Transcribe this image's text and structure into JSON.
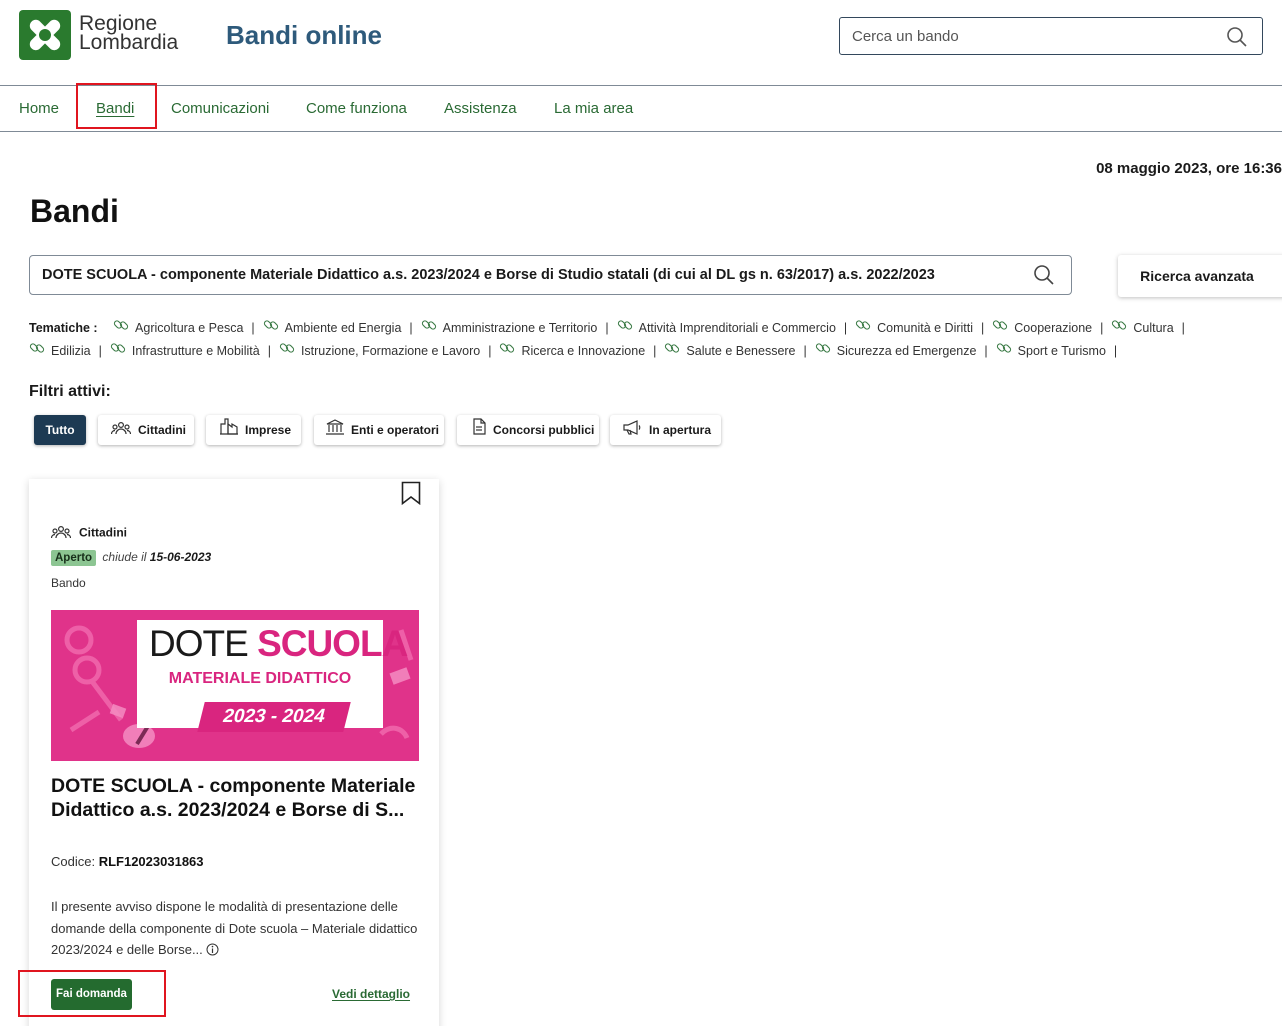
{
  "header": {
    "brand_line1": "Regione",
    "brand_line2": "Lombardia",
    "app_title": "Bandi online",
    "search_placeholder": "Cerca un bando",
    "brand_color": "#2a7a2e",
    "title_color": "#2e5a7b"
  },
  "nav": {
    "items": [
      "Home",
      "Bandi",
      "Comunicazioni",
      "Come funziona",
      "Assistenza",
      "La mia area"
    ],
    "active": "Bandi",
    "link_color": "#2a6a34"
  },
  "datetime": "08 maggio 2023, ore 16:36",
  "page_title": "Bandi",
  "search": {
    "value": "DOTE SCUOLA - componente Materiale Didattico a.s. 2023/2024 e Borse di Studio statali (di cui al DL gs n. 63/2017) a.s. 2022/2023",
    "advanced_label": "Ricerca avanzata"
  },
  "tematiche": {
    "label": "Tematiche :",
    "items": [
      "Agricoltura e Pesca",
      "Ambiente ed Energia",
      "Amministrazione e Territorio",
      "Attività Imprenditoriali e Commercio",
      "Comunità e Diritti",
      "Cooperazione",
      "Cultura",
      "Edilizia",
      "Infrastrutture e Mobilità",
      "Istruzione, Formazione e Lavoro",
      "Ricerca e Innovazione",
      "Salute e Benessere",
      "Sicurezza ed Emergenze",
      "Sport e Turismo"
    ],
    "separator": "|"
  },
  "filters": {
    "label": "Filtri attivi:",
    "chips": [
      {
        "label": "Tutto",
        "icon": null,
        "active": true
      },
      {
        "label": "Cittadini",
        "icon": "people-icon",
        "active": false
      },
      {
        "label": "Imprese",
        "icon": "factory-icon",
        "active": false
      },
      {
        "label": "Enti e operatori",
        "icon": "institution-icon",
        "active": false
      },
      {
        "label": "Concorsi pubblici",
        "icon": "document-icon",
        "active": false
      },
      {
        "label": "In apertura",
        "icon": "megaphone-icon",
        "active": false
      }
    ]
  },
  "card": {
    "category": "Cittadini",
    "status": "Aperto",
    "closes_prefix": "chiude il",
    "closes_date": "15-06-2023",
    "kind": "Bando",
    "banner": {
      "word1": "DOTE",
      "word2": "SCUOLA",
      "subtitle": "MATERIALE DIDATTICO",
      "years": "2023 - 2024"
    },
    "title": "DOTE SCUOLA - componente Materiale Didattico a.s. 2023/2024 e Borse di S...",
    "code_label": "Codice:",
    "code_value": "RLF12023031863",
    "description": "Il presente avviso dispone le modalità di presentazione delle domande della componente di Dote scuola – Materiale didattico 2023/2024 e delle Borse...",
    "apply_label": "Fai domanda",
    "detail_label": "Vedi dettaglio",
    "status_color": "#8cc592",
    "banner_color": "#e0338a",
    "button_color": "#246b2f"
  },
  "highlight_color": "#e0151f"
}
